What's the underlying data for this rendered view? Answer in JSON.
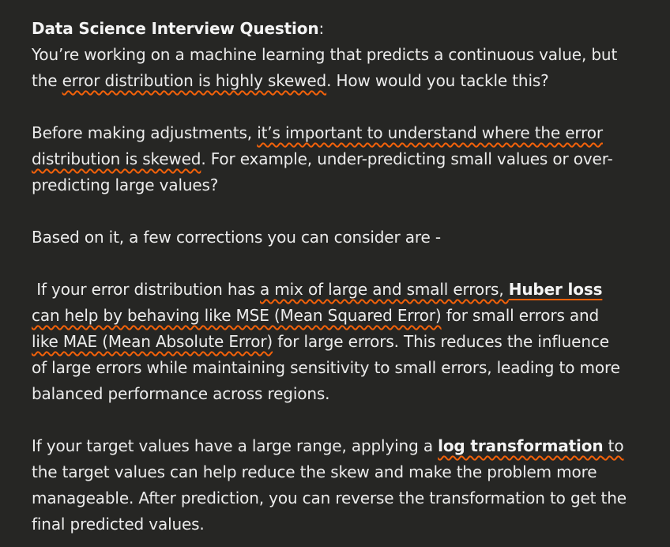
{
  "heading": {
    "title": "Data Science Interview Question",
    "colon": ":"
  },
  "question": {
    "line1": "You’re working on a machine learning that predicts a continuous value, but",
    "line2_pre": "the ",
    "line2_hl": "error distribution is highly skewed",
    "line2_post": ". How would you tackle this?"
  },
  "para2": {
    "line1_pre": "Before making adjustments, ",
    "line1_hl": "it’s important to understand where the error",
    "line2_hl": "distribution is skewed",
    "line2_post": ". For example, under-predicting small values or over-",
    "line3": "predicting large values?"
  },
  "para3": {
    "line1": "Based on it, a few corrections you can consider are -"
  },
  "para4": {
    "line1_pre": " If your error distribution has ",
    "line1_hl": "a mix of large and small errors, ",
    "line1_bold": "Huber loss",
    "line2_hl": "can help by behaving like MSE (Mean Squared Error)",
    "line2_post": " for small errors and",
    "line3_hl": "like MAE (Mean Absolute Error)",
    "line3_post": " for large errors. This reduces the influence",
    "line4": "of large errors while maintaining sensitivity to small errors, leading to more",
    "line5": "balanced performance across regions."
  },
  "para5": {
    "line1_pre": "If your target values have a large range, applying a ",
    "line1_bold": "log transformation",
    "line1_post": " to",
    "line2": "the target values can help reduce the skew and make the problem more",
    "line3": "manageable. After prediction, you can reverse the transformation to get the",
    "line4": "final predicted values."
  },
  "colors": {
    "background": "#262624",
    "text": "#ececec",
    "underline": "#f2610a"
  }
}
